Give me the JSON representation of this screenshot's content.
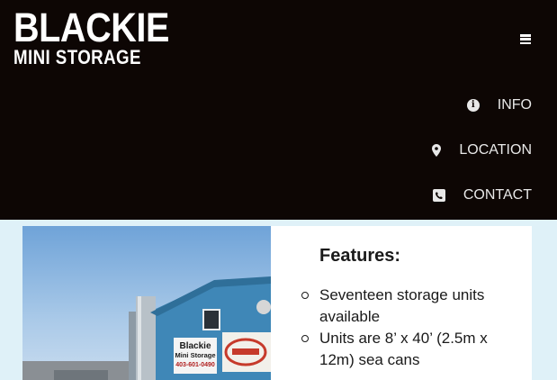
{
  "header": {
    "logo_main": "BLACKIE",
    "logo_sub": "MINI STORAGE"
  },
  "nav": {
    "menu_icon": "hamburger-icon",
    "items": [
      {
        "label": "INFO",
        "icon": "info-circle-icon"
      },
      {
        "label": "LOCATION",
        "icon": "map-pin-icon"
      },
      {
        "label": "CONTACT",
        "icon": "phone-square-icon"
      }
    ]
  },
  "photo": {
    "sign_name": "Blackie",
    "sign_sub": "Mini Storage",
    "sign_phone": "403-601-0490"
  },
  "features": {
    "title": "Features:",
    "items": [
      "Seventeen storage units available",
      "Units are 8’ x 40’ (2.5m x 12m) sea cans"
    ]
  },
  "colors": {
    "header_bg": "#0d0604",
    "page_bg": "#dff1f8",
    "nav_text": "#e8e8e8"
  }
}
